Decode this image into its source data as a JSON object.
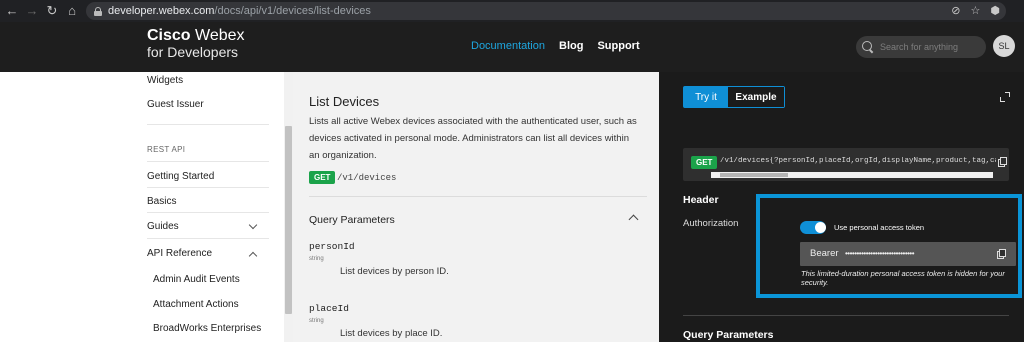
{
  "browser": {
    "url_host": "developer.webex.com",
    "url_path": "/docs/api/v1/devices/list-devices",
    "back": "←",
    "forward": "→",
    "reload": "↻",
    "home": "⌂",
    "eye_off": "⊘",
    "star": "☆",
    "ext": "⬢"
  },
  "header": {
    "logo_strong": "Cisco",
    "logo_rest": " Webex",
    "logo_sub": "for Developers",
    "nav": [
      "Documentation",
      "Blog",
      "Support"
    ],
    "search_placeholder": "Search for anything",
    "avatar": "SL"
  },
  "sidebar": {
    "widgets": "Widgets",
    "guest_issuer": "Guest Issuer",
    "rest_api_section": "REST API",
    "getting_started": "Getting Started",
    "basics": "Basics",
    "guides": "Guides",
    "api_reference": "API Reference",
    "sub_items": [
      "Admin Audit Events",
      "Attachment Actions",
      "BroadWorks Enterprises"
    ]
  },
  "main": {
    "title": "List Devices",
    "description": "Lists all active Webex devices associated with the authenticated user, such as devices activated in personal mode. Administrators can list all devices within an organization.",
    "method": "GET",
    "endpoint": "/v1/devices",
    "query_params_title": "Query Parameters",
    "params": [
      {
        "name": "personId",
        "type": "string",
        "description": "List devices by person ID."
      },
      {
        "name": "placeId",
        "type": "string",
        "description": "List devices by place ID."
      }
    ]
  },
  "tryit": {
    "tabs": [
      "Try it",
      "Example"
    ],
    "method": "GET",
    "request_url": "/v1/devices{?personId,placeId,orgId,displayName,product,tag,ca",
    "header_title": "Header",
    "auth_label": "Authorization",
    "toggle_label": "Use personal access token",
    "token_prefix": "Bearer",
    "token_masked": "••••••••••••••••••••••••••••••",
    "token_note": "This limited-duration personal access token is hidden for your security.",
    "query_params_title": "Query Parameters"
  },
  "colors": {
    "accent": "#0f8fd6",
    "highlight_border": "#0a95d8",
    "get_badge": "#1ba34a",
    "header_bg": "#1e1e1e",
    "panel_bg": "#1b1b1b"
  }
}
